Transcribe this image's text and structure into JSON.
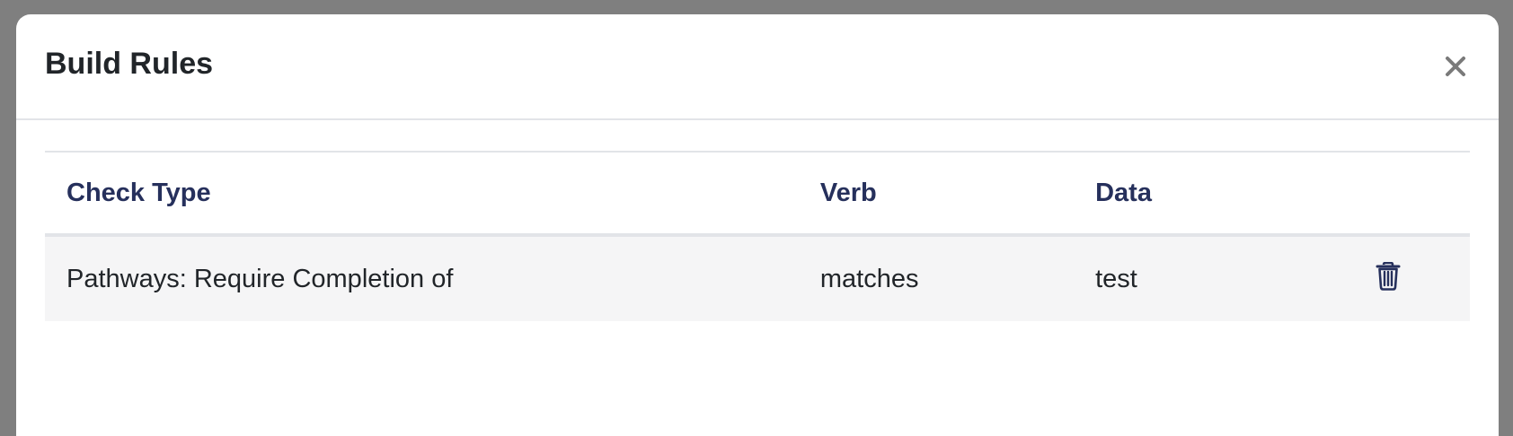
{
  "modal": {
    "title": "Build Rules",
    "close_icon": "close-icon"
  },
  "table": {
    "headers": [
      "Check Type",
      "Verb",
      "Data"
    ],
    "rows": [
      {
        "check_type": "Pathways: Require Completion of",
        "verb": "matches",
        "data": "test",
        "action_icon": "trash-icon"
      }
    ]
  },
  "colors": {
    "header_text": "#26305c",
    "body_text": "#212529",
    "row_background": "#f5f5f6",
    "backdrop": "#7f7f7f"
  }
}
